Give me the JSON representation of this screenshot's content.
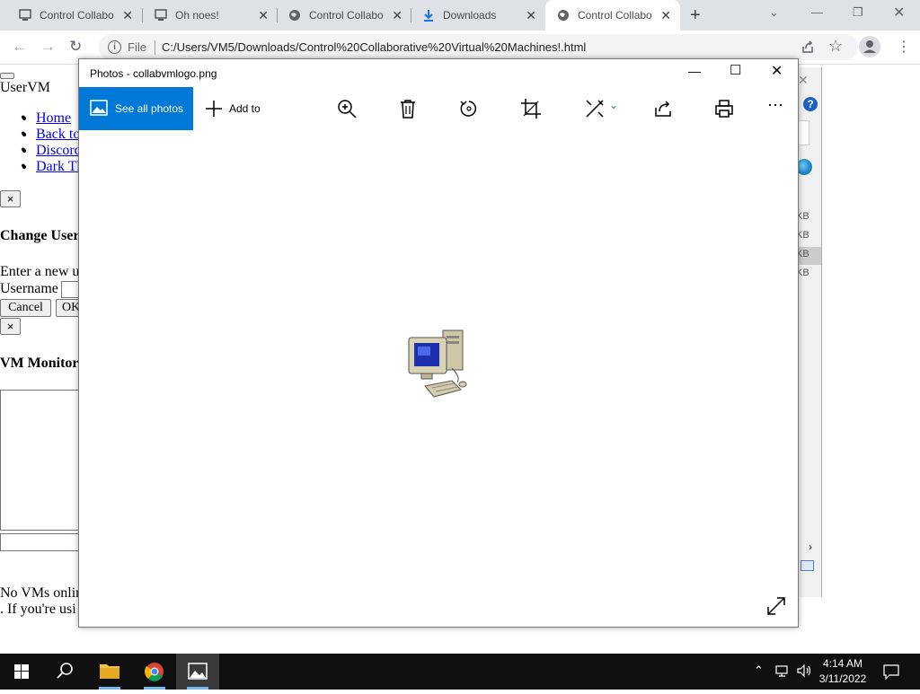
{
  "browser": {
    "tabs": [
      {
        "title": "Control Collabo",
        "icon": "collabvm-favicon",
        "active": false
      },
      {
        "title": "Oh noes!",
        "icon": "collabvm-favicon",
        "active": false
      },
      {
        "title": "Control Collabo",
        "icon": "globe-icon",
        "active": false
      },
      {
        "title": "Downloads",
        "icon": "download-icon",
        "active": false
      },
      {
        "title": "Control Collabo",
        "icon": "globe-icon",
        "active": true
      }
    ],
    "new_tab": "+",
    "address": {
      "scheme_label": "File",
      "url": "C:/Users/VM5/Downloads/Control%20Collaborative%20Virtual%20Machines!.html"
    }
  },
  "page": {
    "site_title": "UserVM",
    "nav_links": [
      "Home",
      "Back to",
      "Discord",
      "Dark Th"
    ],
    "close_x": "×",
    "change_username_heading": "Change User",
    "enter_new_text": "Enter a new u",
    "username_label": "Username",
    "cancel_button": "Cancel",
    "ok_button": "OK",
    "close_x2": "×",
    "vm_monitor_heading": "VM Monitor",
    "no_vms_text": "No VMs onlin",
    "if_using_text": ". If you're usi"
  },
  "background_window": {
    "size_cells": [
      "KB",
      "KB",
      "KB",
      "KB"
    ]
  },
  "photos": {
    "title": "Photos - collabvmlogo.png",
    "see_all_label": "See all photos",
    "add_to_label": "Add to",
    "image_name": "computer-icon"
  },
  "taskbar": {
    "time": "4:14 AM",
    "date": "3/11/2022"
  },
  "colors": {
    "accent": "#0078d7",
    "tabstrip": "#dee1e6",
    "taskbar": "#101010"
  }
}
